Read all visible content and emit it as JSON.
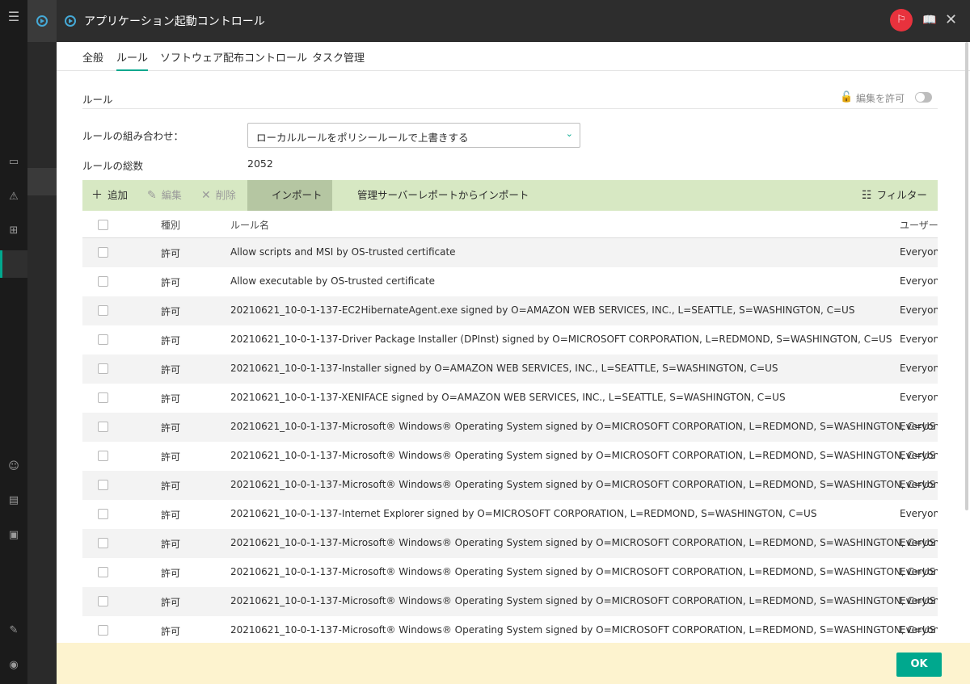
{
  "window": {
    "title": "アプリケーション起動コントロール",
    "icons": [
      "menu-icon",
      "back-circle-icon",
      "title-circle-icon",
      "flag-icon",
      "book-icon",
      "close-icon"
    ]
  },
  "rail_icons": [
    "menu-icon",
    "monitor-icon",
    "warning-icon",
    "tree-icon",
    "user-icon",
    "report-icon",
    "devices-icon",
    "wrench-icon",
    "account-icon"
  ],
  "tabs": [
    {
      "label": "全般",
      "active": false
    },
    {
      "label": "ルール",
      "active": true
    },
    {
      "label": "ソフトウェア配布コントロール",
      "active": false
    },
    {
      "label": "タスク管理",
      "active": false
    }
  ],
  "section": {
    "title": "ルール",
    "allow_edit_label": "編集を許可",
    "allow_edit_on": false
  },
  "form": {
    "combo_label": "ルールの組み合わせ：",
    "combo_value": "ローカルルールをポリシールールで上書きする",
    "total_label": "ルールの総数",
    "total_value": "2052"
  },
  "toolbar": {
    "add": "追加",
    "edit": "編集",
    "delete": "削除",
    "import": "インポート",
    "import_report": "管理サーバーレポートからインポート",
    "filter": "フィルター"
  },
  "table": {
    "columns": {
      "type": "種別",
      "name": "ルール名",
      "user": "ユーザー"
    },
    "rows": [
      {
        "type": "許可",
        "name": "Allow scripts and MSI by OS-trusted certificate",
        "user": "Everyone"
      },
      {
        "type": "許可",
        "name": "Allow executable by OS-trusted certificate",
        "user": "Everyone"
      },
      {
        "type": "許可",
        "name": "20210621_10-0-1-137-EC2HibernateAgent.exe signed by O=AMAZON WEB SERVICES, INC., L=SEATTLE, S=WASHINGTON, C=US",
        "user": "Everyone"
      },
      {
        "type": "許可",
        "name": "20210621_10-0-1-137-Driver Package Installer (DPInst) signed by O=MICROSOFT CORPORATION, L=REDMOND, S=WASHINGTON, C=US",
        "user": "Everyone"
      },
      {
        "type": "許可",
        "name": "20210621_10-0-1-137-Installer signed by O=AMAZON WEB SERVICES, INC., L=SEATTLE, S=WASHINGTON, C=US",
        "user": "Everyone"
      },
      {
        "type": "許可",
        "name": "20210621_10-0-1-137-XENIFACE signed by O=AMAZON WEB SERVICES, INC., L=SEATTLE, S=WASHINGTON, C=US",
        "user": "Everyone"
      },
      {
        "type": "許可",
        "name": "20210621_10-0-1-137-Microsoft® Windows® Operating System signed by O=MICROSOFT CORPORATION, L=REDMOND, S=WASHINGTON, C=US",
        "user": "Everyone"
      },
      {
        "type": "許可",
        "name": "20210621_10-0-1-137-Microsoft® Windows® Operating System signed by O=MICROSOFT CORPORATION, L=REDMOND, S=WASHINGTON, C=US",
        "user": "Everyone"
      },
      {
        "type": "許可",
        "name": "20210621_10-0-1-137-Microsoft® Windows® Operating System signed by O=MICROSOFT CORPORATION, L=REDMOND, S=WASHINGTON, C=US",
        "user": "Everyone"
      },
      {
        "type": "許可",
        "name": "20210621_10-0-1-137-Internet Explorer signed by O=MICROSOFT CORPORATION, L=REDMOND, S=WASHINGTON, C=US",
        "user": "Everyone"
      },
      {
        "type": "許可",
        "name": "20210621_10-0-1-137-Microsoft® Windows® Operating System signed by O=MICROSOFT CORPORATION, L=REDMOND, S=WASHINGTON, C=US",
        "user": "Everyone"
      },
      {
        "type": "許可",
        "name": "20210621_10-0-1-137-Microsoft® Windows® Operating System signed by O=MICROSOFT CORPORATION, L=REDMOND, S=WASHINGTON, C=US",
        "user": "Everyone"
      },
      {
        "type": "許可",
        "name": "20210621_10-0-1-137-Microsoft® Windows® Operating System signed by O=MICROSOFT CORPORATION, L=REDMOND, S=WASHINGTON, C=US",
        "user": "Everyone"
      },
      {
        "type": "許可",
        "name": "20210621_10-0-1-137-Microsoft® Windows® Operating System signed by O=MICROSOFT CORPORATION, L=REDMOND, S=WASHINGTON, C=US",
        "user": "Everyone"
      }
    ]
  },
  "footer": {
    "ok_label": "OK"
  },
  "colors": {
    "accent": "#00a88e",
    "toolbar_bg": "#d7e8c3",
    "footer_bg": "#fdf3cf",
    "flag_red": "#e8323d"
  }
}
